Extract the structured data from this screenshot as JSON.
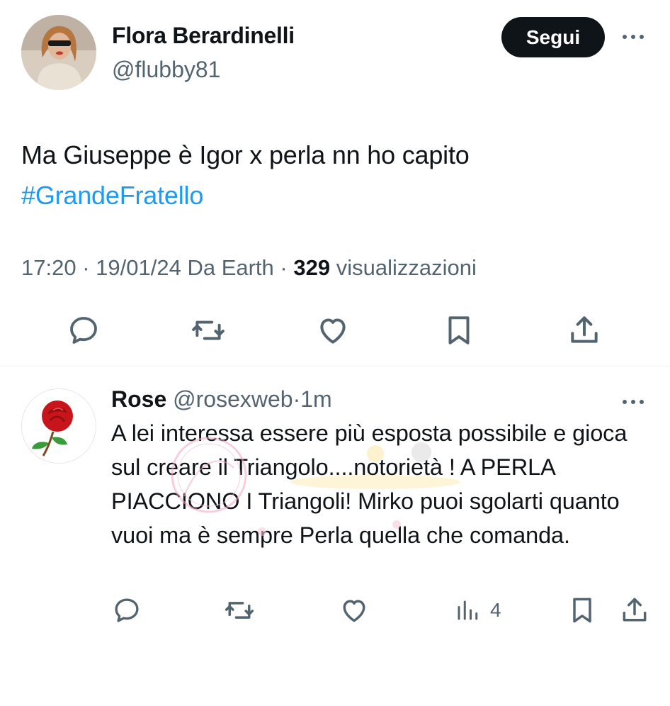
{
  "main_tweet": {
    "author_name": "Flora Berardinelli",
    "author_handle": "@flubby81",
    "follow_label": "Segui",
    "text_line1": "Ma Giuseppe è Igor x perla nn ho capito",
    "hashtag": "#GrandeFratello",
    "time": "17:20",
    "separator": "·",
    "date": "19/01/24",
    "source": "Da Earth",
    "views_count": "329",
    "views_label": "visualizzazioni",
    "actions": [
      "reply-icon",
      "retweet-icon",
      "like-icon",
      "bookmark-icon",
      "share-icon"
    ]
  },
  "reply": {
    "author_name": "Rose",
    "author_handle": "@rosexweb",
    "separator": "·",
    "time": "1m",
    "text": "A lei interessa essere più esposta possibile e gioca sul creare il Triangolo....notorietà ! A PERLA PIACCIONO I Triangoli! Mirko puoi sgolarti quanto vuoi ma è sempre Perla quella che comanda.",
    "views_count": "4",
    "actions": [
      "reply-icon",
      "retweet-icon",
      "like-icon",
      "analytics-icon",
      "bookmark-icon",
      "share-icon"
    ]
  },
  "colors": {
    "text_primary": "#0f1419",
    "text_secondary": "#536471",
    "hashtag": "#1d9bf0",
    "follow_bg": "#0f1419",
    "divider": "#eff3f4"
  }
}
